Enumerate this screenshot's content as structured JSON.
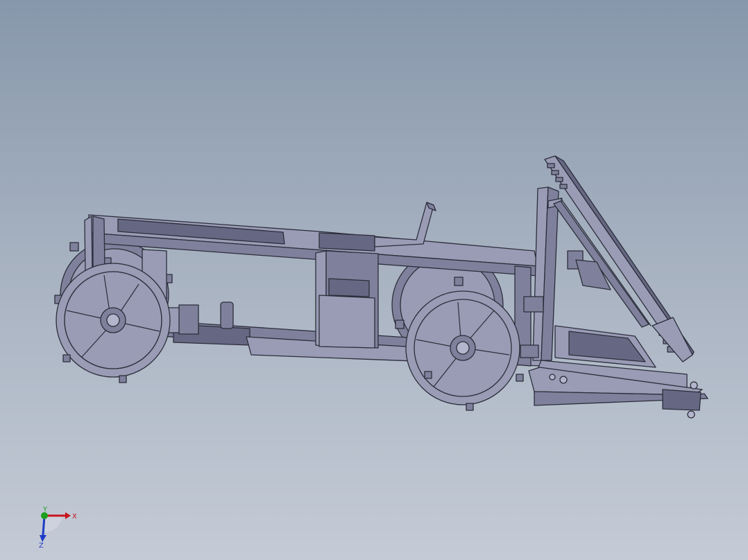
{
  "viewport": {
    "background_top": "#8797ab",
    "background_bottom": "#c4cbd6",
    "model_fill": "#9a9cb6",
    "edge_color": "#2b2d3a"
  },
  "triad": {
    "x_label": "X",
    "y_label": "Y",
    "z_label": "Z",
    "x_color": "#c8141e",
    "y_color": "#1ea01e",
    "z_color": "#1e3cc8"
  }
}
